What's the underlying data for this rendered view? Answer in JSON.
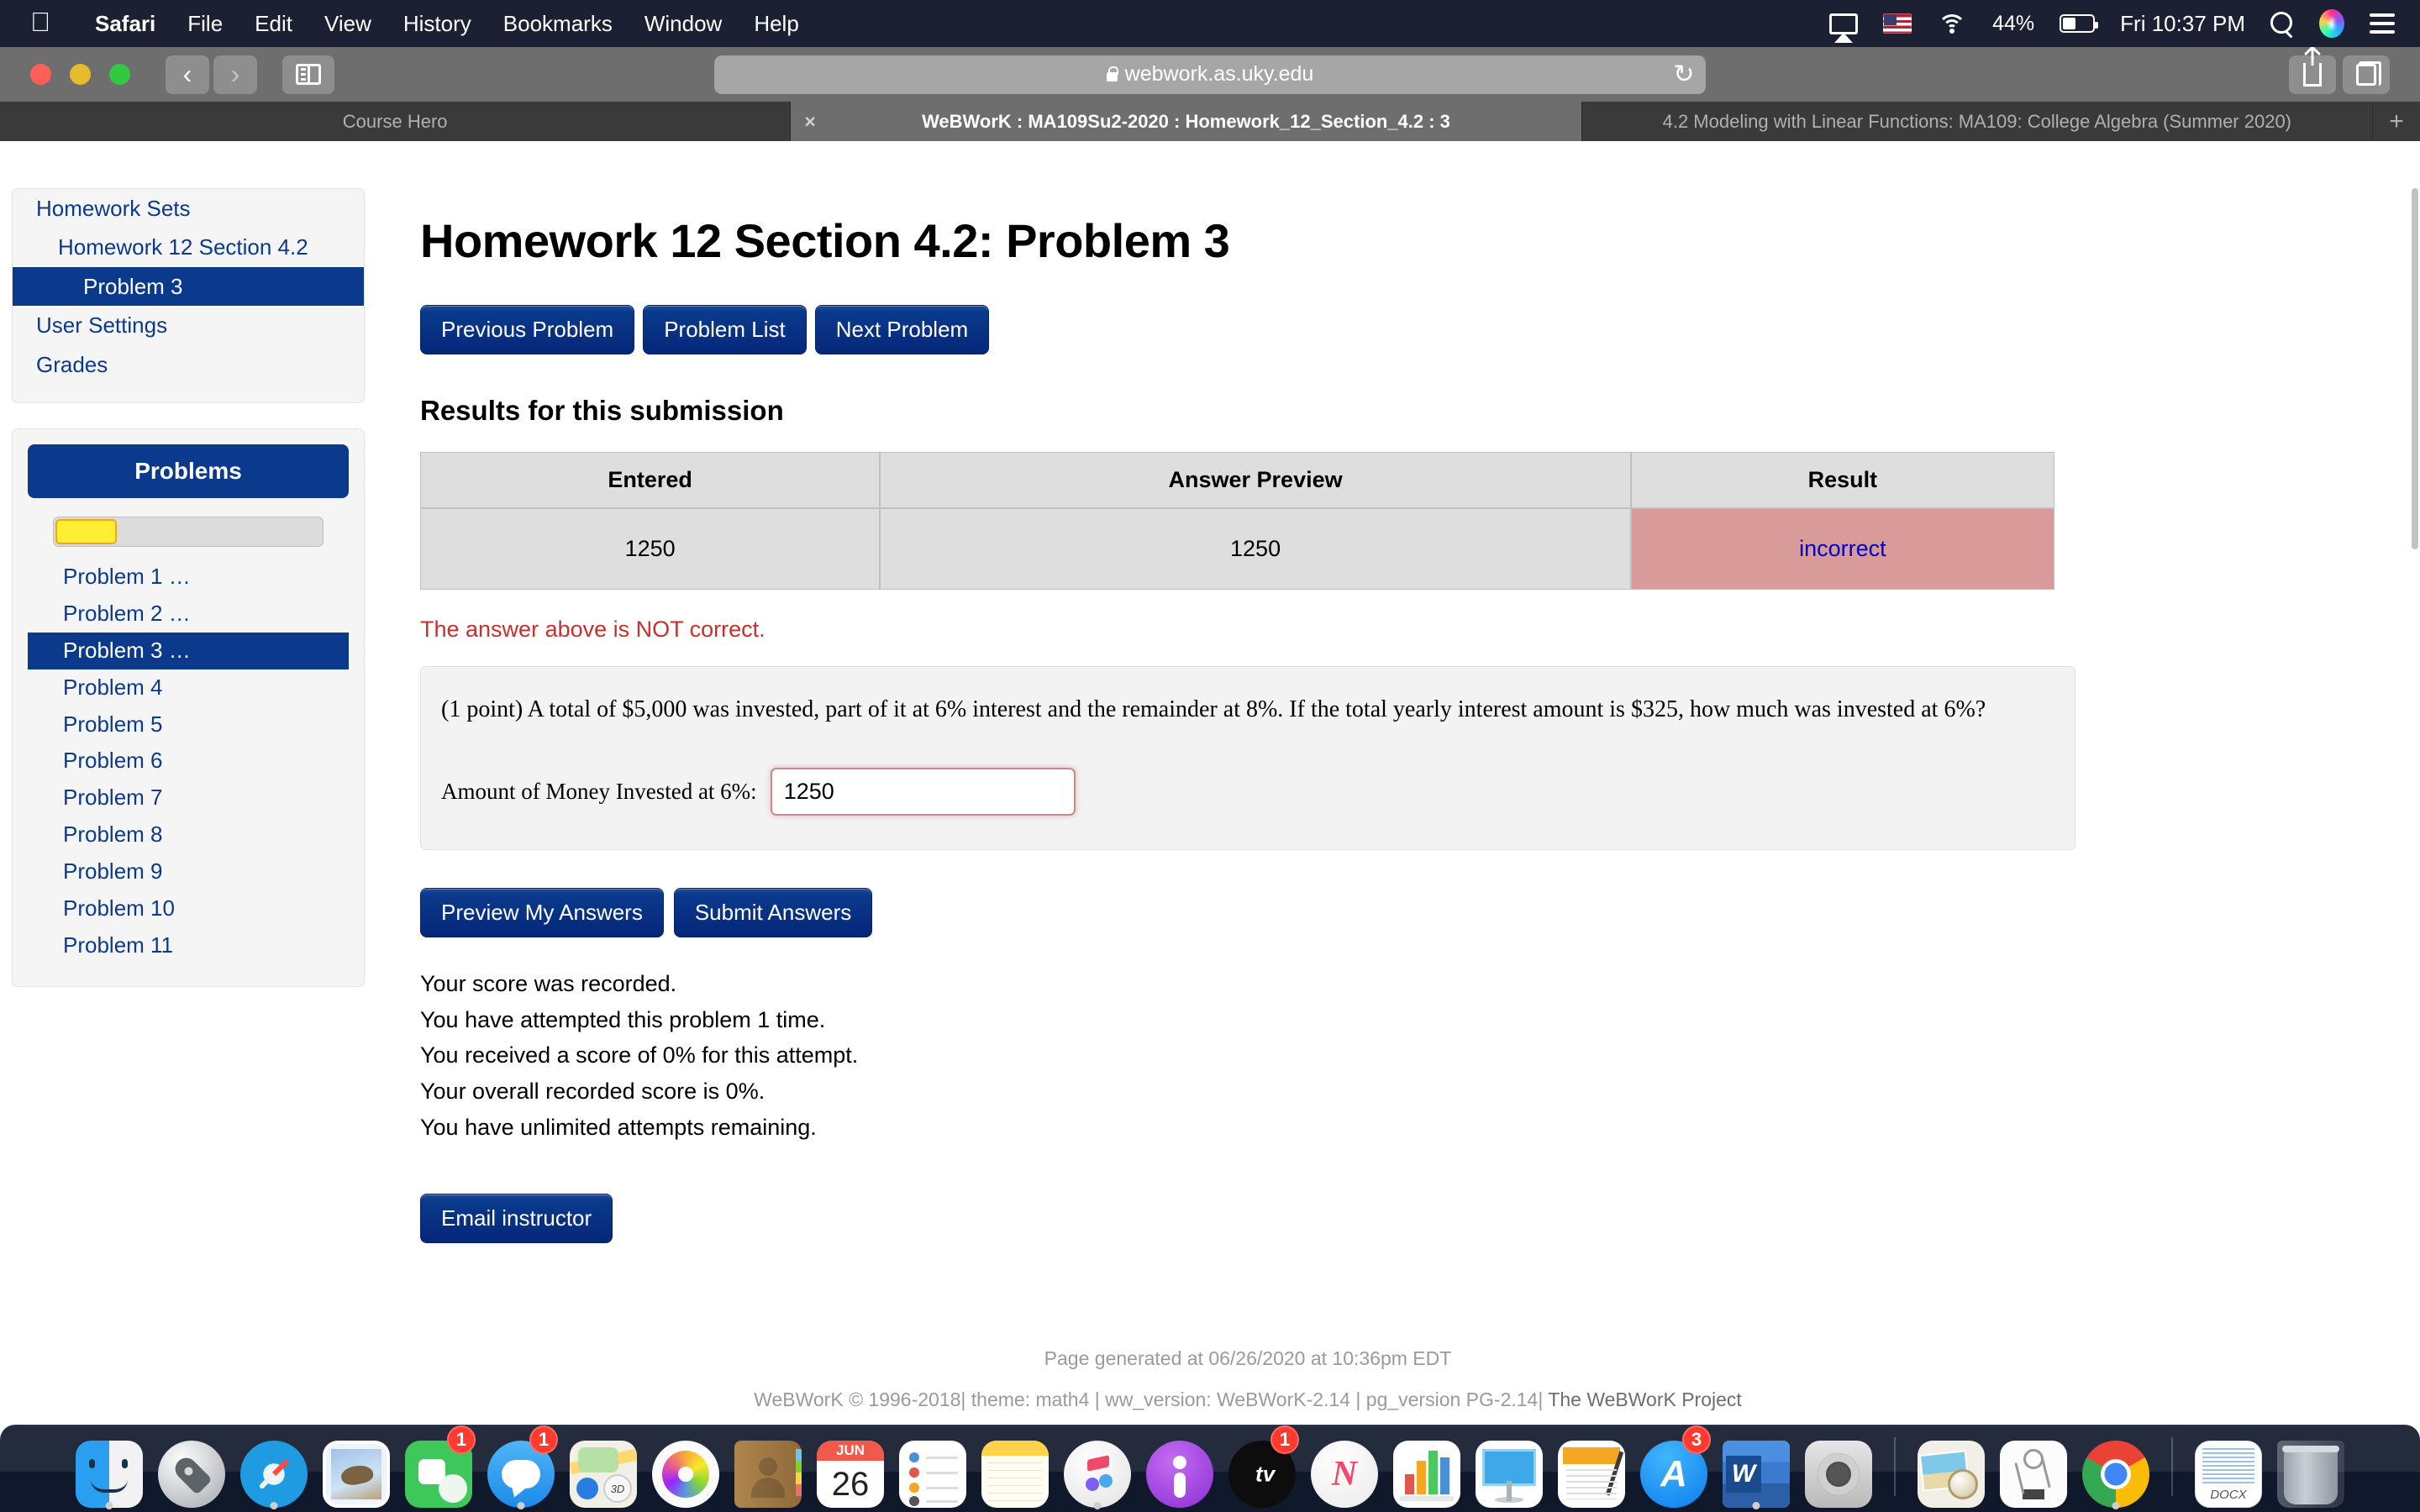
{
  "menubar": {
    "apple_glyph": "●",
    "items": [
      "Safari",
      "File",
      "Edit",
      "View",
      "History",
      "Bookmarks",
      "Window",
      "Help"
    ],
    "battery_percent": "44%",
    "clock": "Fri 10:37 PM",
    "icons": [
      "airplay-icon",
      "us-flag-icon",
      "wifi-icon",
      "battery-icon",
      "search-icon",
      "siri-icon",
      "control-center-icon"
    ]
  },
  "browser": {
    "url": "webwork.as.uky.edu",
    "reload_glyph": "↻",
    "back_glyph": "‹",
    "forward_glyph": "›",
    "tabs": [
      {
        "title": "Course Hero",
        "active": false,
        "has_close": false
      },
      {
        "title": "WeBWorK : MA109Su2-2020 : Homework_12_Section_4.2 : 3",
        "active": true,
        "has_close": true
      },
      {
        "title": "4.2 Modeling with Linear Functions: MA109: College Algebra (Summer 2020)",
        "active": false,
        "has_close": false
      }
    ],
    "new_tab_glyph": "+"
  },
  "sidebar": {
    "nav": [
      {
        "label": "Homework Sets",
        "level": 1,
        "active": false
      },
      {
        "label": "Homework 12 Section 4.2",
        "level": 2,
        "active": false
      },
      {
        "label": "Problem 3",
        "level": 3,
        "active": true
      },
      {
        "label": "User Settings",
        "level": 1,
        "active": false
      },
      {
        "label": "Grades",
        "level": 1,
        "active": false
      }
    ],
    "problems_header": "Problems",
    "progress_percent": 23,
    "problems": [
      {
        "label": "Problem 1 …",
        "active": false
      },
      {
        "label": "Problem 2 …",
        "active": false
      },
      {
        "label": "Problem 3 …",
        "active": true
      },
      {
        "label": "Problem 4",
        "active": false
      },
      {
        "label": "Problem 5",
        "active": false
      },
      {
        "label": "Problem 6",
        "active": false
      },
      {
        "label": "Problem 7",
        "active": false
      },
      {
        "label": "Problem 8",
        "active": false
      },
      {
        "label": "Problem 9",
        "active": false
      },
      {
        "label": "Problem 10",
        "active": false
      },
      {
        "label": "Problem 11",
        "active": false
      }
    ]
  },
  "main": {
    "title": "Homework 12 Section 4.2: Problem 3",
    "nav_buttons": {
      "previous": "Previous Problem",
      "list": "Problem List",
      "next": "Next Problem"
    },
    "results_heading": "Results for this submission",
    "results_table": {
      "headers": [
        "Entered",
        "Answer Preview",
        "Result"
      ],
      "rows": [
        {
          "entered": "1250",
          "preview": "1250",
          "result": "incorrect"
        }
      ]
    },
    "not_correct_message": "The answer above is NOT correct.",
    "problem": {
      "points": "(1 point)",
      "statement": "(1 point) A total of $5,000 was invested, part of it at 6% interest and the remainder at 8%. If the total yearly interest amount is $325, how much was invested at 6%?",
      "answer_label": "Amount of Money Invested at 6%:",
      "answer_value": "1250"
    },
    "action_buttons": {
      "preview": "Preview My Answers",
      "submit": "Submit Answers"
    },
    "score_lines": [
      "Your score was recorded.",
      "You have attempted this problem 1 time.",
      "You received a score of 0% for this attempt.",
      "Your overall recorded score is 0%.",
      "You have unlimited attempts remaining."
    ],
    "email_button": "Email instructor"
  },
  "footer": {
    "generated": "Page generated at 06/26/2020 at 10:36pm EDT",
    "version_prefix": "WeBWorK © 1996-2018| theme: math4 | ww_version: WeBWorK-2.14 | pg_version PG-2.14| ",
    "project_link": "The WeBWorK Project"
  },
  "colors": {
    "brand_blue": "#0b3a8c",
    "incorrect_bg": "#d99a9a",
    "error_text": "#c9302c",
    "progress_fill": "#ffee33"
  },
  "dock": {
    "items": [
      {
        "name": "finder",
        "badge": null,
        "running": true
      },
      {
        "name": "launchpad",
        "badge": null,
        "running": false
      },
      {
        "name": "safari",
        "badge": null,
        "running": true
      },
      {
        "name": "mail",
        "badge": null,
        "running": false
      },
      {
        "name": "facetime",
        "badge": "1",
        "running": false
      },
      {
        "name": "messages",
        "badge": "1",
        "running": true
      },
      {
        "name": "maps",
        "badge": null,
        "running": false,
        "label": "3D"
      },
      {
        "name": "photos",
        "badge": null,
        "running": false
      },
      {
        "name": "contacts",
        "badge": null,
        "running": false
      },
      {
        "name": "calendar",
        "badge": null,
        "running": false,
        "month": "JUN",
        "day": "26"
      },
      {
        "name": "reminders",
        "badge": null,
        "running": false
      },
      {
        "name": "notes",
        "badge": null,
        "running": false
      },
      {
        "name": "itunes",
        "badge": null,
        "running": true
      },
      {
        "name": "podcasts",
        "badge": null,
        "running": false
      },
      {
        "name": "apple-tv",
        "badge": "1",
        "running": false,
        "label": " tv"
      },
      {
        "name": "news",
        "badge": null,
        "running": false,
        "label": "N"
      },
      {
        "name": "numbers",
        "badge": null,
        "running": false
      },
      {
        "name": "keynote",
        "badge": null,
        "running": false
      },
      {
        "name": "pages",
        "badge": null,
        "running": false
      },
      {
        "name": "app-store",
        "badge": "3",
        "running": false,
        "label": "A"
      },
      {
        "name": "microsoft-word",
        "badge": null,
        "running": true,
        "label": "W"
      },
      {
        "name": "system-preferences",
        "badge": null,
        "running": false
      }
    ],
    "items2": [
      {
        "name": "preview",
        "badge": null,
        "running": false
      },
      {
        "name": "spice",
        "badge": null,
        "running": false
      },
      {
        "name": "google-chrome",
        "badge": null,
        "running": true
      }
    ],
    "items3": [
      {
        "name": "docx-file",
        "badge": null,
        "running": false,
        "label": "DOCX"
      },
      {
        "name": "trash",
        "badge": null,
        "running": false
      }
    ]
  }
}
